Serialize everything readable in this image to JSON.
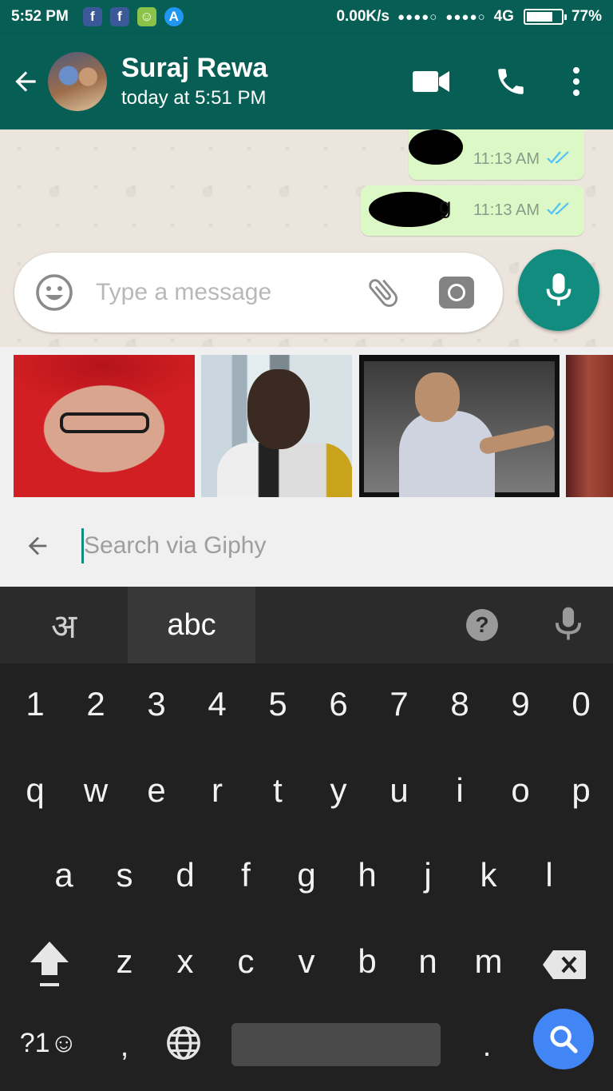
{
  "status_bar": {
    "time": "5:52 PM",
    "notifications": [
      {
        "icon": "facebook-icon",
        "glyph": "f",
        "color": "#3b5998"
      },
      {
        "icon": "facebook-icon",
        "glyph": "f",
        "color": "#3b5998"
      },
      {
        "icon": "android-icon",
        "glyph": "☺",
        "color": "#8bc34a"
      },
      {
        "icon": "app-store-icon",
        "glyph": "A",
        "color": "#2196f3"
      }
    ],
    "network_speed": "0.00K/s",
    "signal1": "●●●●○",
    "signal2": "●●●●○",
    "network_type": "4G",
    "battery_level": 0.77,
    "battery_text": "77%"
  },
  "header": {
    "contact_name": "Suraj Rewa",
    "last_seen": "today at 5:51 PM",
    "accent_color": "#075e54"
  },
  "messages": [
    {
      "time": "11:13 AM",
      "status": "read"
    },
    {
      "time": "11:13 AM",
      "status": "read",
      "visible_char": "g"
    }
  ],
  "composer": {
    "placeholder": "Type a message"
  },
  "gif_panel": {
    "search_placeholder": "Search via Giphy",
    "gifs": [
      "gif-red-graduate",
      "gif-man-smiling",
      "gif-wrestler",
      "gif-partial"
    ]
  },
  "keyboard": {
    "tabs": {
      "hindi": "अ",
      "abc": "abc"
    },
    "help": "?",
    "rows": [
      [
        "1",
        "2",
        "3",
        "4",
        "5",
        "6",
        "7",
        "8",
        "9",
        "0"
      ],
      [
        "q",
        "w",
        "e",
        "r",
        "t",
        "y",
        "u",
        "i",
        "o",
        "p"
      ],
      [
        "a",
        "s",
        "d",
        "f",
        "g",
        "h",
        "j",
        "k",
        "l"
      ],
      [
        "z",
        "x",
        "c",
        "v",
        "b",
        "n",
        "m"
      ]
    ],
    "symbols_key": "?1☺",
    "comma": ",",
    "period": "."
  }
}
